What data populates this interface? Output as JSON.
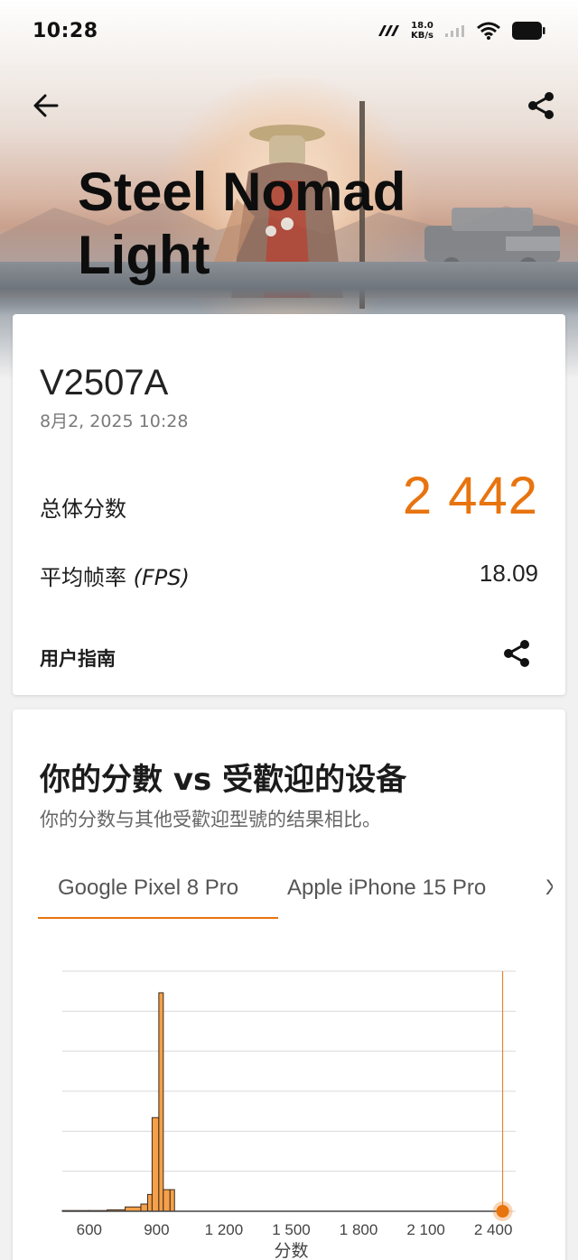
{
  "status_bar": {
    "time": "10:28",
    "net_speed_value": "18.0",
    "net_speed_unit": "KB/s",
    "battery": "full"
  },
  "header": {
    "title": "Steel Nomad Light",
    "title_line1": "Steel Nomad",
    "title_line2": "Light",
    "back_icon": "arrow-left-icon",
    "share_icon": "share-icon"
  },
  "result": {
    "device": "V2507A",
    "date": "8月2, 2025 10:28",
    "score_label": "总体分数",
    "score_value": "2 442",
    "fps_label": "平均帧率",
    "fps_unit": "(FPS)",
    "fps_value": "18.09",
    "guide_label": "用户指南"
  },
  "compare": {
    "title": "你的分數 vs 受歡迎的设备",
    "subtitle": "你的分数与其他受歡迎型號的结果相比。",
    "tabs": [
      {
        "label": "Google Pixel 8 Pro",
        "active": true
      },
      {
        "label": "Apple iPhone 15 Pro",
        "active": false
      },
      {
        "label": "X",
        "active": false
      }
    ]
  },
  "chart_data": {
    "type": "bar",
    "xlabel": "分数",
    "x_ticks": [
      "600",
      "900",
      "1 200",
      "1 500",
      "1 800",
      "2 100",
      "2 400"
    ],
    "x_tick_values": [
      600,
      900,
      1200,
      1500,
      1800,
      2100,
      2400
    ],
    "xlim": [
      480,
      2500
    ],
    "ylim": [
      0,
      1.0
    ],
    "grid": true,
    "bin_edges": [
      480,
      600,
      680,
      760,
      830,
      860,
      880,
      910,
      930,
      960,
      980,
      1000
    ],
    "values": [
      0.003,
      0.003,
      0.006,
      0.018,
      0.03,
      0.07,
      0.39,
      0.91,
      0.09,
      0.09,
      0.0
    ],
    "marker_value": 2442,
    "bar_color": "#f5a04a",
    "marker_color": "#e8740f"
  }
}
